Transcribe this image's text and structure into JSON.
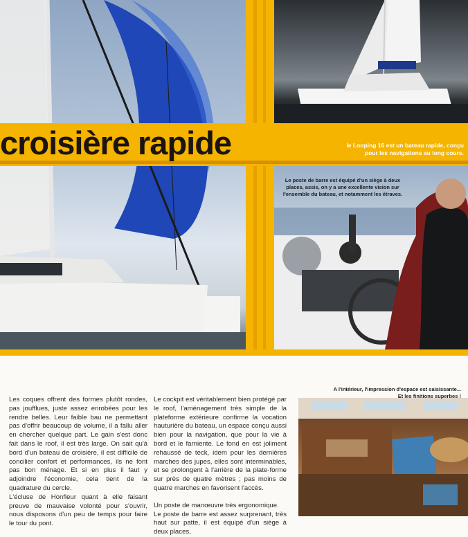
{
  "header": {
    "title": "croisière rapide",
    "caption_boat": "le Looping 16 est un bateau rapide, conçu pour les navigations au long cours.",
    "caption_cockpit": "Le poste de barre est équipé d'un siège à deux places, assis, on y a une excellente vision sur l'ensemble du bateau, et notamment les étraves.",
    "caption_interior_line1": "A l'intérieur, l'impression d'espace est saisissante...",
    "caption_interior_line2": "Et les finitions superbes !"
  },
  "article": {
    "col1": [
      "Les coques offrent des formes plutôt rondes, pas joufflues, juste assez enrobées pour les rendre belles. Leur faible bau ne permettant pas d'offrir beaucoup de volume, il a fallu aller en chercher quelque part. Le gain s'est donc fait dans le roof, il est très large. On sait qu'à bord d'un bateau de croisière, il est difficile de concilier confort et performances, ils ne font pas bon ménage. Et si en plus il faut y adjoindre l'économie, cela tient de la quadrature du cercle.",
      "L'écluse de Honfleur quant à elle faisant preuve de mauvaise volonté pour s'ouvrir, nous disposons d'un peu de temps pour faire le tour du pont."
    ],
    "col2": [
      "Le cockpit est véritablement bien protégé par le roof, l'aménagement très simple de la plateforme extérieure confirme la vocation hauturière du bateau, un espace conçu aussi bien pour la navigation, que pour la vie à bord et le farniente. Le fond en est joliment rehaussé de teck, idem pour les dernières marches des jupes, elles sont interminables, et se prolongent à l'arrière de la plate-forme sur près de quatre mètres ; pas moins de quatre marches en favorisent l'accès.",
      "Un poste de manœuvre très ergonomique.",
      "Le poste de barre est assez surprenant, très haut sur patte, il est équipé d'un siège à deux places,"
    ]
  },
  "colors": {
    "band_yellow": "#f4b400",
    "band_orange": "#e8a000",
    "title_color": "#1c1410"
  }
}
